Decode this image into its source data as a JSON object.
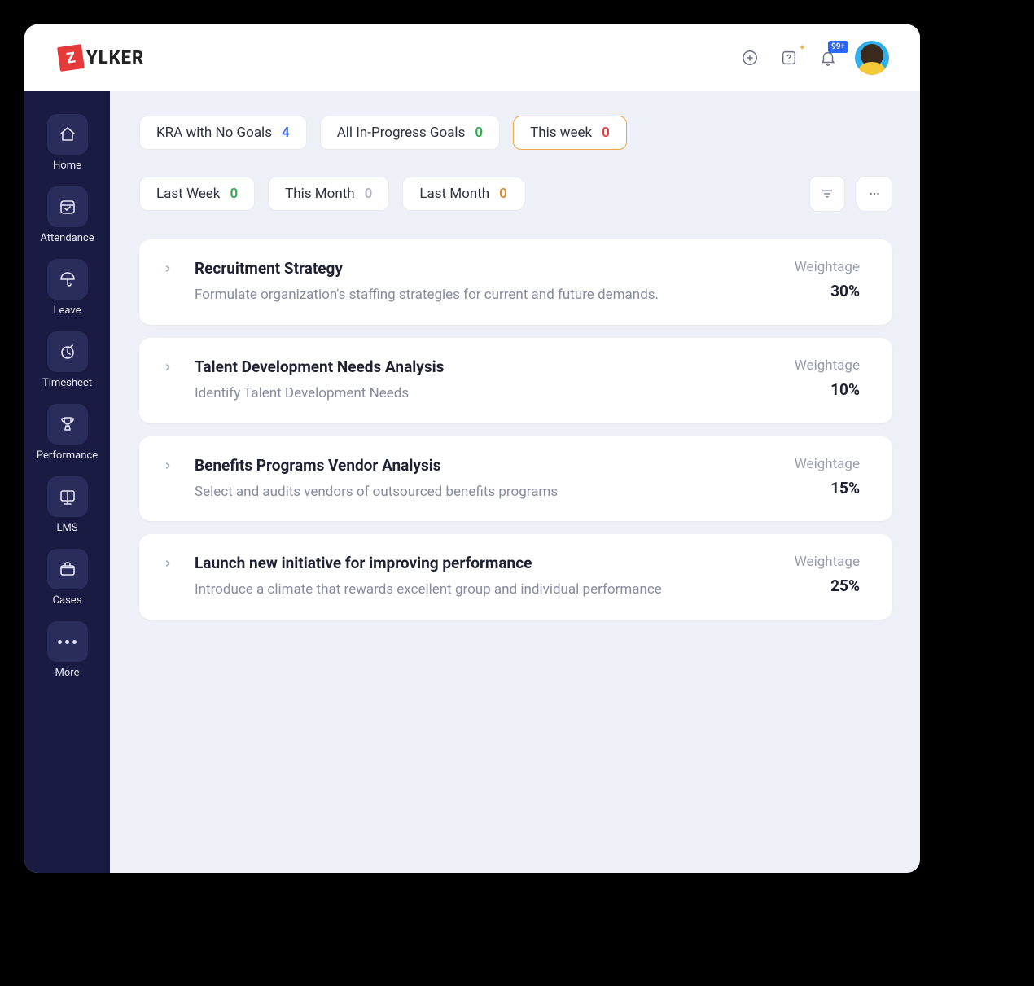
{
  "brand": {
    "mark": "Z",
    "text": "YLKER"
  },
  "header": {
    "notification_badge": "99+"
  },
  "sidebar": {
    "items": [
      {
        "label": "Home",
        "icon": "home"
      },
      {
        "label": "Attendance",
        "icon": "calendar-check"
      },
      {
        "label": "Leave",
        "icon": "umbrella"
      },
      {
        "label": "Timesheet",
        "icon": "clock"
      },
      {
        "label": "Performance",
        "icon": "trophy"
      },
      {
        "label": "LMS",
        "icon": "board"
      },
      {
        "label": "Cases",
        "icon": "briefcase"
      },
      {
        "label": "More",
        "icon": "more"
      }
    ]
  },
  "filters": [
    {
      "label": "KRA with No Goals",
      "count": "4",
      "count_color": "c-blue",
      "active": false
    },
    {
      "label": "All In-Progress Goals",
      "count": "0",
      "count_color": "c-green",
      "active": false
    },
    {
      "label": "This week",
      "count": "0",
      "count_color": "c-red",
      "active": true
    },
    {
      "label": "Last Week",
      "count": "0",
      "count_color": "c-green",
      "active": false
    },
    {
      "label": "This Month",
      "count": "0",
      "count_color": "c-grey",
      "active": false
    },
    {
      "label": "Last Month",
      "count": "0",
      "count_color": "c-amber",
      "active": false
    }
  ],
  "weightage_label": "Weightage",
  "kras": [
    {
      "title": "Recruitment Strategy",
      "desc": "Formulate organization's staffing strategies for current and future demands.",
      "weight": "30%"
    },
    {
      "title": "Talent Development Needs Analysis",
      "desc": "Identify Talent Development Needs",
      "weight": "10%"
    },
    {
      "title": "Benefits Programs Vendor Analysis",
      "desc": "Select and audits vendors of outsourced benefits programs",
      "weight": "15%"
    },
    {
      "title": "Launch new initiative for improving performance",
      "desc": "Introduce a climate that rewards excellent group and individual performance",
      "weight": "25%"
    }
  ]
}
